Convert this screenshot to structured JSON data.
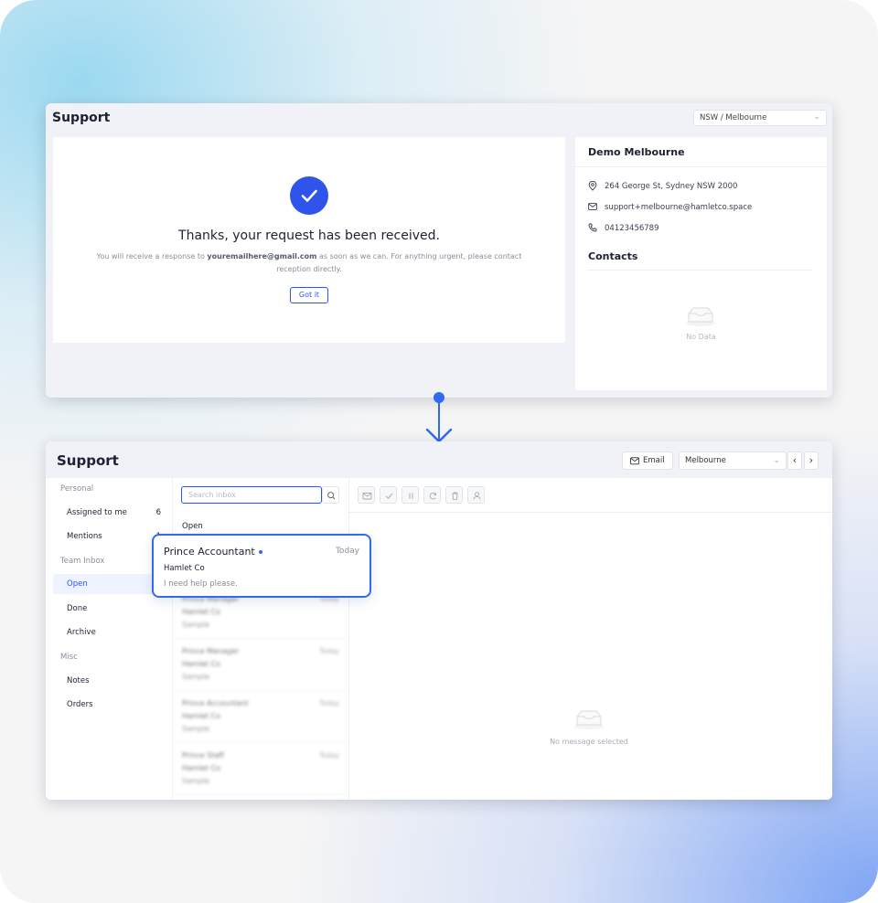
{
  "colors": {
    "accent": "#2f54eb",
    "connector": "#2f6bea"
  },
  "top_window": {
    "title": "Support",
    "location_select": "NSW / Melbourne",
    "confirmation": {
      "heading": "Thanks, your request has been received.",
      "message_pre": "You will receive a response to",
      "message_email": "youremailhere@gmail.com",
      "message_post": "as soon as we can. For anything urgent, please contact reception directly.",
      "button": "Got it"
    },
    "location_card": {
      "name": "Demo Melbourne",
      "address": "264 George St, Sydney NSW 2000",
      "email": "support+melbourne@hamletco.space",
      "phone": "04123456789",
      "contacts_title": "Contacts",
      "empty_text": "No Data"
    }
  },
  "bottom_window": {
    "title": "Support",
    "email_button": "Email",
    "location_select": "Melbourne",
    "sidebar": {
      "personal_label": "Personal",
      "assigned_label": "Assigned to me",
      "assigned_count": "6",
      "mentions_label": "Mentions",
      "mentions_count": "1",
      "team_inbox_label": "Team Inbox",
      "open_label": "Open",
      "done_label": "Done",
      "archive_label": "Archive",
      "misc_label": "Misc",
      "notes_label": "Notes",
      "orders_label": "Orders"
    },
    "inbox": {
      "search_placeholder": "Search inbox",
      "section_label": "Open",
      "blurred_items": [
        {
          "name": "Prince Manager",
          "company": "Hamlet Co",
          "preview": "Sample",
          "date": "Today"
        },
        {
          "name": "Prince Manager",
          "company": "Hamlet Co",
          "preview": "Sample",
          "date": "Today"
        },
        {
          "name": "Prince Accountant",
          "company": "Hamlet Co",
          "preview": "Sample",
          "date": "Today"
        },
        {
          "name": "Prince Staff",
          "company": "Hamlet Co",
          "preview": "Sample",
          "date": "Today"
        }
      ]
    },
    "detail": {
      "empty_text": "No message selected"
    },
    "highlighted_message": {
      "name": "Prince Accountant",
      "date": "Today",
      "company": "Hamlet Co",
      "preview": "I need help please."
    }
  }
}
